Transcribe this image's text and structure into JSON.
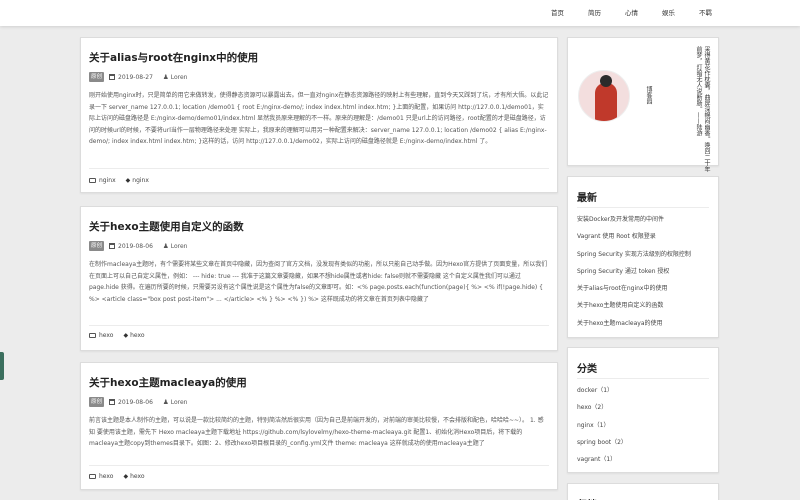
{
  "nav": [
    "首页",
    "简历",
    "心情",
    "娱乐",
    "不羁"
  ],
  "posts": [
    {
      "title": "关于alias与root在nginx中的使用",
      "badge": "原创",
      "date": "2019-08-27",
      "author": "Loren",
      "excerpt": "刚开始使用nginx时，只是简单的用它来做转发，使得静态资源可以暴露出去。但一直对nginx在静态资源路径的映射上有些理解，直到今天又踩到了坑，才有所大悟。以此记录一下 server_name 127.0.0.1; location /demo01 { root E:/nginx-demo/; index index.html index.htm; }上面的配置，如果访问 http://127.0.0.1/demo01，实际上访问的磁盘路径是 E:/nginx-demo/demo01/index.html 显然我员原来理解的不一样。原来的理解是：/demo01 只是url上的访问路径，root配置的才是磁盘路径，访问的时候url的时候，不要将url当作一层物理路径来处理 实际上，我原来的理解可以用另一种配置来解决：server_name 127.0.0.1; location /demo02 { alias E:/nginx-demo/; index index.html index.htm; }这样的话，访问 http://127.0.0.1/demo02，实际上访问的磁盘路径就是 E:/nginx-demo/index.html 了。",
      "category": "nginx",
      "tag": "nginx"
    },
    {
      "title": "关于hexo主题使用自定义的函数",
      "badge": "原创",
      "date": "2019-08-06",
      "author": "Loren",
      "excerpt": "在制作macleaya主题时，有个需要将某些文章在首页中隐藏，因为查阅了官方文档，没发现有类似的功能，所以只能自己动手做。因为Hexo官方提供了页面变量，所以我们在页面上可以自己自定义属性，例如： --- hide: true --- 我准于这篇文章要隐藏，如果不想hide属性或者hide: false则就不需要隐藏 这个自定义属性我们可以通过 page.hide 获得。在遍历所要的时候，只需要另设有这个属性说是这个属性为false的文章即可。如：<% page.posts.each(function(page){ %> <% if(!page.hide) { %> <article class=\"box post post-item\"> ... </article> <% } %> <% }) %> 这样既成功的将文章在首页列表中隐藏了",
      "category": "hexo",
      "tag": "hexo"
    },
    {
      "title": "关于hexo主题macleaya的使用",
      "badge": "原创",
      "date": "2019-08-06",
      "author": "Loren",
      "excerpt": "前言该主题是本人制作的主题，可以说是一款比较简约的主题，特别简洁然后很实用（因为自己是前端开发的，对前端的审美比较慢，不会排版和配色，哈哈哈~~）。 1. 感知 要使用该主题，需先下 Hexo macleaya主题下载地址 https://github.com/lsylovelmy/hexo-theme-macleaya.git 配置1、初始化消Hexo项目后，将下载的macleaya主题copy到themes目录下。如图：2、修改hexo项目根目录的_config.yml文件 theme: macleaya 这样就成功的使用macleaya主题了",
      "category": "hexo",
      "tag": "hexo"
    }
  ],
  "profile": {
    "name": "博客园",
    "poem": "采得黄花作枕囊，曲屏深幌闷幽香。唤回二十年前梦，灯暗无人说断肠。——陆游"
  },
  "recent": {
    "title": "最新",
    "items": [
      "安装Docker及开发常用的中间件",
      "Vagrant 使用 Root 权限登录",
      "Spring Security 实现方法级别的权限控制",
      "Spring Security 通过 token 授权",
      "关于alias与root在nginx中的使用",
      "关于hexo主题使用自定义的函数",
      "关于hexo主题macleaya的使用"
    ]
  },
  "categories": {
    "title": "分类",
    "items": [
      "docker（1）",
      "hexo（2）",
      "nginx（1）",
      "spring boot（2）",
      "vagrant（1）"
    ]
  },
  "archive": {
    "title": "归档"
  }
}
